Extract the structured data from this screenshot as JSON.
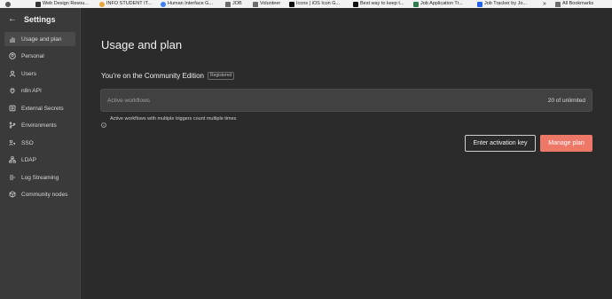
{
  "colors": {
    "background": "#2b2b2b",
    "sidebar_bg": "#3a3a3a",
    "card_bg": "#414141",
    "primary_button": "#ee7868",
    "bookmarks_bg": "#f2f2f2"
  },
  "bookmarks": [
    {
      "label": "",
      "icon": "window-icon"
    },
    {
      "label": "Web Design Resou...",
      "icon": "bookmark-favicon"
    },
    {
      "label": "INFO STUDENT IT...",
      "icon": "bookmark-favicon"
    },
    {
      "label": "Human Interface G...",
      "icon": "apple-favicon"
    },
    {
      "label": "JOB",
      "icon": "folder-icon"
    },
    {
      "label": "Volunteer",
      "icon": "folder-icon"
    },
    {
      "label": "Icons | iOS Icon G...",
      "icon": "bookmark-favicon"
    },
    {
      "label": "Best way to keep t...",
      "icon": "bookmark-favicon"
    },
    {
      "label": "Job Application Tr...",
      "icon": "bookmark-favicon"
    },
    {
      "label": "Job Tracker by Jo...",
      "icon": "bookmark-favicon"
    },
    {
      "label": "»",
      "icon": ""
    },
    {
      "label": "All Bookmarks",
      "icon": "folder-icon"
    }
  ],
  "sidebar": {
    "back_icon": "arrow-left-icon",
    "title": "Settings",
    "items": [
      {
        "label": "Usage and plan",
        "icon": "chart-icon",
        "active": true
      },
      {
        "label": "Personal",
        "icon": "user-circle-icon",
        "active": false
      },
      {
        "label": "Users",
        "icon": "user-icon",
        "active": false
      },
      {
        "label": "n8n API",
        "icon": "plug-icon",
        "active": false
      },
      {
        "label": "External Secrets",
        "icon": "vault-icon",
        "active": false
      },
      {
        "label": "Environments",
        "icon": "branch-icon",
        "active": false
      },
      {
        "label": "SSO",
        "icon": "sso-icon",
        "active": false
      },
      {
        "label": "LDAP",
        "icon": "network-icon",
        "active": false
      },
      {
        "label": "Log Streaming",
        "icon": "stream-icon",
        "active": false
      },
      {
        "label": "Community nodes",
        "icon": "cube-icon",
        "active": false
      }
    ]
  },
  "main": {
    "title": "Usage and plan",
    "edition": "You're on the Community Edition",
    "badge": "Registered",
    "card": {
      "label": "Active workflows",
      "value": "20 of unlimited"
    },
    "note": "Active workflows with multiple triggers count multiple times",
    "buttons": {
      "activation": "Enter activation key",
      "manage": "Manage plan"
    }
  }
}
